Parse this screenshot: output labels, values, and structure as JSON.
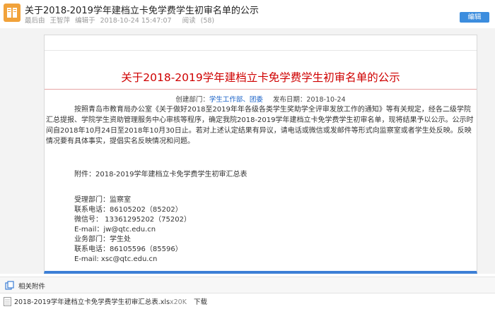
{
  "header": {
    "title": "关于2018-2019学年建档立卡免学费学生初审名单的公示",
    "meta_author_label": "最后由",
    "meta_author": "王智萍",
    "meta_edit_label": "编辑于",
    "meta_edit_time": "2018-10-24 15:47:07",
    "meta_reads_label": "阅读",
    "meta_reads": "(58)",
    "edit_button": "编辑"
  },
  "document": {
    "title": "关于2018-2019学年建档立卡免学费学生初审名单的公示",
    "creator_label": "创建部门：",
    "creator_dept": "学生工作部、团委",
    "publish_label": "发布日期：",
    "publish_date": "2018-10-24",
    "body": "按照青岛市教育局办公室《关于做好2018至2019年年各级各类学生奖助学全评审发放工作的通知》等有关规定，经各二级学院汇总提报、学院学生资助管理服务中心审核等程序，确定我院2018-2019学年建档立卡免学费学生初审名单，现将结果予以公示。公示时间自2018年10月24日至2018年10月30日止。若对上述认定结果有异议，请电话或微信或发邮件等形式向监察室或者学生处反映。反映情况要有具体事实，提倡实名反映情况和问题。",
    "attachment": "附件：2018-2019学年建档立卡免学费学生初审汇总表",
    "contacts": [
      "受理部门：监察室",
      "联系电话：86105202（85202）",
      "微信号： 13361295202（75202）",
      "E-mail：jw@qtc.edu.cn",
      "业务部门：学生处",
      "联系电话：86105596（85596）",
      "E-mail: xsc@qtc.edu.cn"
    ]
  },
  "attachments": {
    "label": "相关附件",
    "file_name": "2018-2019学年建档立卡免学费学生初审汇总表.xls",
    "file_size": "x20K",
    "download": "下载"
  }
}
